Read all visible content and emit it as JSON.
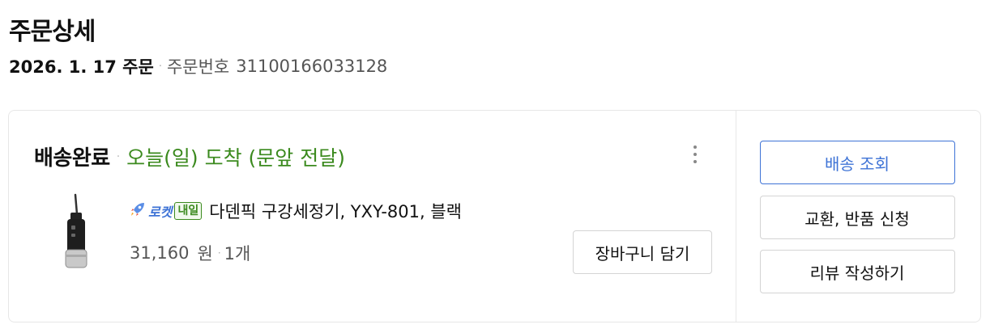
{
  "page": {
    "title": "주문상세",
    "order_date": "2026. 1. 17 주문",
    "order_number_label": "주문번호",
    "order_number": "31100166033128"
  },
  "shipment": {
    "status": "배송완료",
    "arrival": "오늘(일) 도착 (문앞 전달)",
    "status_color": "#3b8a1e"
  },
  "product": {
    "badge_rocket": "로켓",
    "badge_tomorrow": "내일",
    "name": "다덴픽 구강세정기, YXY-801, 블랙",
    "price": "31,160",
    "price_unit": "원",
    "quantity": "1개",
    "cart_button": "장바구니 담기"
  },
  "actions": {
    "track": "배송 조회",
    "return": "교환, 반품 신청",
    "review": "리뷰 작성하기"
  },
  "colors": {
    "accent": "#3e73d6",
    "green": "#3b8a1e"
  },
  "icons": {
    "more": "more-vertical-icon",
    "rocket": "rocket-icon"
  }
}
